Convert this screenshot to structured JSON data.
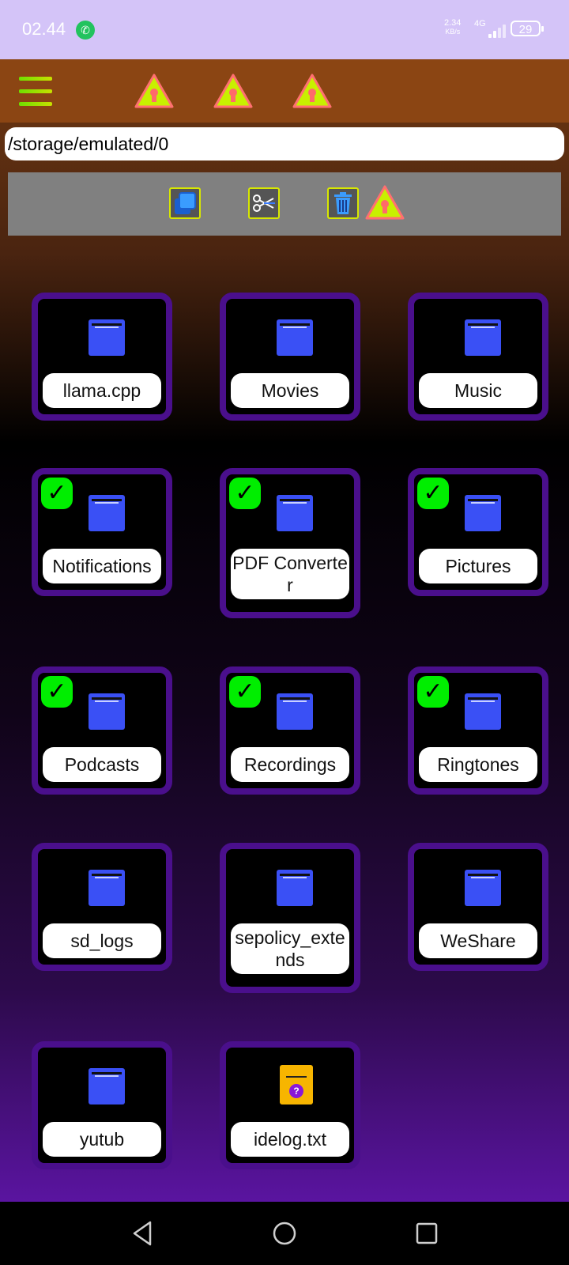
{
  "status_bar": {
    "time": "02.44",
    "net_speed_value": "2.34",
    "net_speed_unit": "KB/s",
    "network": "4G",
    "battery": "29",
    "notification_icon": "whatsapp-icon"
  },
  "toolbar": {
    "menu_icon": "hamburger-icon",
    "warning_icon": "warning-icon"
  },
  "path": "/storage/emulated/0",
  "actions": [
    {
      "name": "copy",
      "icon": "copy-icon"
    },
    {
      "name": "cut",
      "icon": "scissors-icon"
    },
    {
      "name": "delete",
      "icon": "trash-icon"
    }
  ],
  "files": [
    {
      "name": "llama.cpp",
      "type": "folder",
      "selected": false
    },
    {
      "name": "Movies",
      "type": "folder",
      "selected": false
    },
    {
      "name": "Music",
      "type": "folder",
      "selected": false
    },
    {
      "name": "Notifications",
      "type": "folder",
      "selected": true
    },
    {
      "name": "PDF Converter",
      "type": "folder",
      "selected": true
    },
    {
      "name": "Pictures",
      "type": "folder",
      "selected": true
    },
    {
      "name": "Podcasts",
      "type": "folder",
      "selected": true
    },
    {
      "name": "Recordings",
      "type": "folder",
      "selected": true
    },
    {
      "name": "Ringtones",
      "type": "folder",
      "selected": true
    },
    {
      "name": "sd_logs",
      "type": "folder",
      "selected": false
    },
    {
      "name": "sepolicy_extends",
      "type": "folder",
      "selected": false
    },
    {
      "name": "WeShare",
      "type": "folder",
      "selected": false
    },
    {
      "name": "yutub",
      "type": "folder",
      "selected": false
    },
    {
      "name": "idelog.txt",
      "type": "file",
      "selected": false
    }
  ],
  "check_mark": "✓",
  "colors": {
    "toolbar": "#8b4513",
    "status_bar": "#d4c4f8",
    "tile_border": "#4a0f8c",
    "folder": "#3a50f5",
    "check": "#00ee00",
    "file": "#f7b500"
  },
  "nav": {
    "back_icon": "back-triangle-icon",
    "home_icon": "home-circle-icon",
    "recents_icon": "recents-square-icon"
  }
}
